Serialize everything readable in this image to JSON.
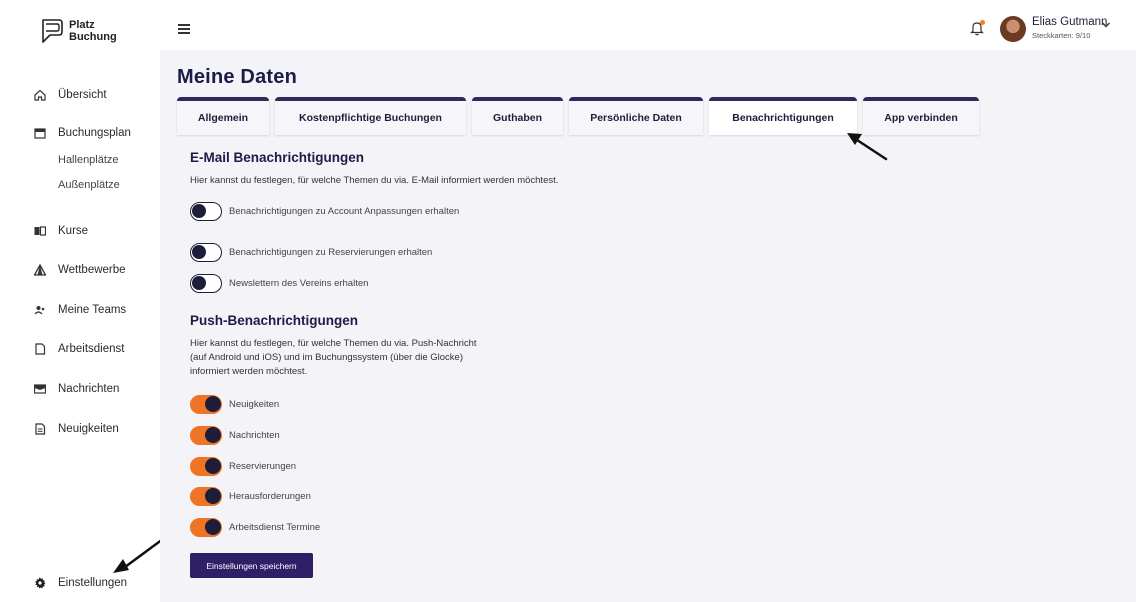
{
  "app": {
    "logo_line1": "Platz",
    "logo_line2": "Buchung"
  },
  "sidebar": {
    "items": [
      {
        "label": "Übersicht",
        "icon": "home-icon"
      },
      {
        "label": "Buchungsplan",
        "icon": "calendar-icon"
      },
      {
        "label": "Hallenplätze"
      },
      {
        "label": "Außenplätze"
      },
      {
        "label": "Kurse",
        "icon": "book-icon"
      },
      {
        "label": "Wettbewerbe",
        "icon": "triangle-icon"
      },
      {
        "label": "Meine Teams",
        "icon": "users-icon"
      },
      {
        "label": "Arbeitsdienst",
        "icon": "document-icon"
      },
      {
        "label": "Nachrichten",
        "icon": "mail-icon"
      },
      {
        "label": "Neuigkeiten",
        "icon": "news-icon"
      }
    ],
    "settings_label": "Einstellungen"
  },
  "topbar": {
    "user_name": "Elias Gutmann",
    "user_sub": "Steckkarten: 9/10"
  },
  "page": {
    "title": "Meine Daten",
    "tabs": [
      {
        "label": "Allgemein"
      },
      {
        "label": "Kostenpflichtige Buchungen"
      },
      {
        "label": "Guthaben"
      },
      {
        "label": "Persönliche Daten"
      },
      {
        "label": "Benachrichtigungen"
      },
      {
        "label": "App verbinden"
      }
    ],
    "active_tab": "Benachrichtigungen"
  },
  "email_section": {
    "title": "E-Mail Benachrichtigungen",
    "description": "Hier kannst du festlegen, für welche Themen du via. E-Mail informiert werden möchtest.",
    "toggles": [
      {
        "label": "Benachrichtigungen zu Account Anpassungen erhalten",
        "on": false
      },
      {
        "label": "Benachrichtigungen zu Reservierungen erhalten",
        "on": false
      },
      {
        "label": "Newslettern des Vereins erhalten",
        "on": false
      }
    ]
  },
  "push_section": {
    "title": "Push-Benachrichtigungen",
    "description": "Hier kannst du festlegen, für welche Themen du via. Push-Nachricht (auf Android und iOS) und im Buchungssystem (über die Glocke) informiert werden möchtest.",
    "toggles": [
      {
        "label": "Neuigkeiten",
        "on": true
      },
      {
        "label": "Nachrichten",
        "on": true
      },
      {
        "label": "Reservierungen",
        "on": true
      },
      {
        "label": "Herausforderungen",
        "on": true
      },
      {
        "label": "Arbeitsdienst Termine",
        "on": true
      }
    ]
  },
  "save_label": "Einstellungen speichern",
  "colors": {
    "accent": "#f07425",
    "primary": "#2e1f67",
    "notification_dot": "#f2831f"
  }
}
